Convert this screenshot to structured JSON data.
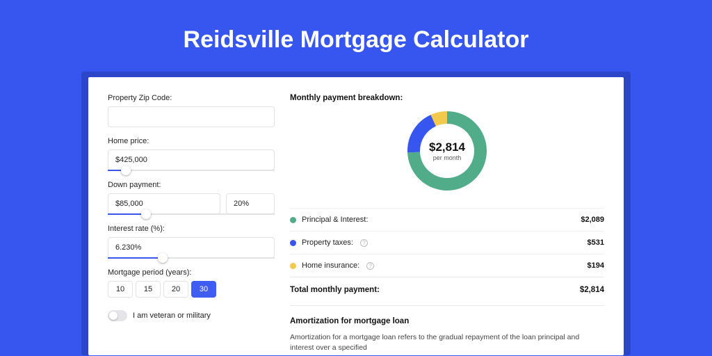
{
  "title": "Reidsville Mortgage Calculator",
  "form": {
    "zip": {
      "label": "Property Zip Code:",
      "value": ""
    },
    "price": {
      "label": "Home price:",
      "value": "$425,000",
      "slider_pct": 8
    },
    "down": {
      "label": "Down payment:",
      "value": "$85,000",
      "pct": "20%",
      "slider_pct": 20
    },
    "rate": {
      "label": "Interest rate (%):",
      "value": "6.230%",
      "slider_pct": 30
    },
    "period": {
      "label": "Mortgage period (years):",
      "options": [
        "10",
        "15",
        "20",
        "30"
      ],
      "selected": "30"
    },
    "veteran_label": "I am veteran or military"
  },
  "breakdown": {
    "title": "Monthly payment breakdown:",
    "center_amount": "$2,814",
    "center_sub": "per month",
    "items": [
      {
        "label": "Principal & Interest:",
        "value": "$2,089",
        "color": "green",
        "info": false
      },
      {
        "label": "Property taxes:",
        "value": "$531",
        "color": "blue",
        "info": true
      },
      {
        "label": "Home insurance:",
        "value": "$194",
        "color": "yellow",
        "info": true
      }
    ],
    "total_label": "Total monthly payment:",
    "total_value": "$2,814"
  },
  "amort": {
    "title": "Amortization for mortgage loan",
    "text": "Amortization for a mortgage loan refers to the gradual repayment of the loan principal and interest over a specified"
  },
  "chart_data": {
    "type": "pie",
    "title": "Monthly payment breakdown",
    "series": [
      {
        "name": "Principal & Interest",
        "value": 2089,
        "color": "#51ac8a"
      },
      {
        "name": "Property taxes",
        "value": 531,
        "color": "#3656ef"
      },
      {
        "name": "Home insurance",
        "value": 194,
        "color": "#f2c94c"
      }
    ],
    "total": 2814,
    "center_label": "$2,814 per month"
  }
}
